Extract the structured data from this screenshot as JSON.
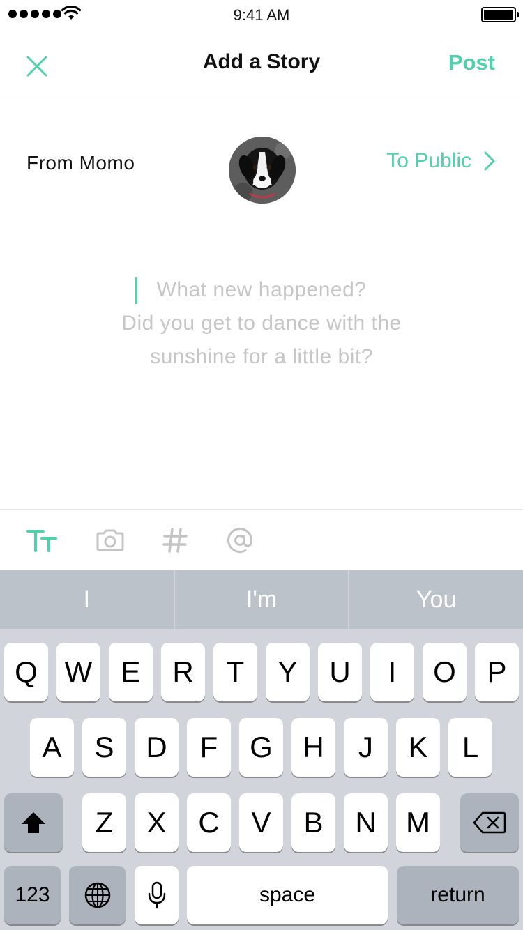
{
  "status": {
    "time": "9:41 AM"
  },
  "nav": {
    "title": "Add a Story",
    "post_label": "Post"
  },
  "composer": {
    "from_label": "From Momo",
    "to_label": "To Public",
    "placeholder_lines": [
      "What new happened?",
      "Did you get to dance with the",
      "sunshine for a little bit?"
    ]
  },
  "colors": {
    "accent": "#4fd1ae",
    "placeholder": "#c6c6c6",
    "keyboard_bg": "#d1d5db",
    "suggestion_bar": "#bcc2ca",
    "dark_key": "#acb3bc"
  },
  "toolbar": {
    "icons": [
      "text-format-icon",
      "camera-icon",
      "hashtag-icon",
      "mention-icon"
    ]
  },
  "keyboard": {
    "suggestions": [
      "I",
      "I'm",
      "You"
    ],
    "row1": [
      "Q",
      "W",
      "E",
      "R",
      "T",
      "Y",
      "U",
      "I",
      "O",
      "P"
    ],
    "row2": [
      "A",
      "S",
      "D",
      "F",
      "G",
      "H",
      "J",
      "K",
      "L"
    ],
    "row3": [
      "Z",
      "X",
      "C",
      "V",
      "B",
      "N",
      "M"
    ],
    "numbers_label": "123",
    "space_label": "space",
    "return_label": "return"
  }
}
